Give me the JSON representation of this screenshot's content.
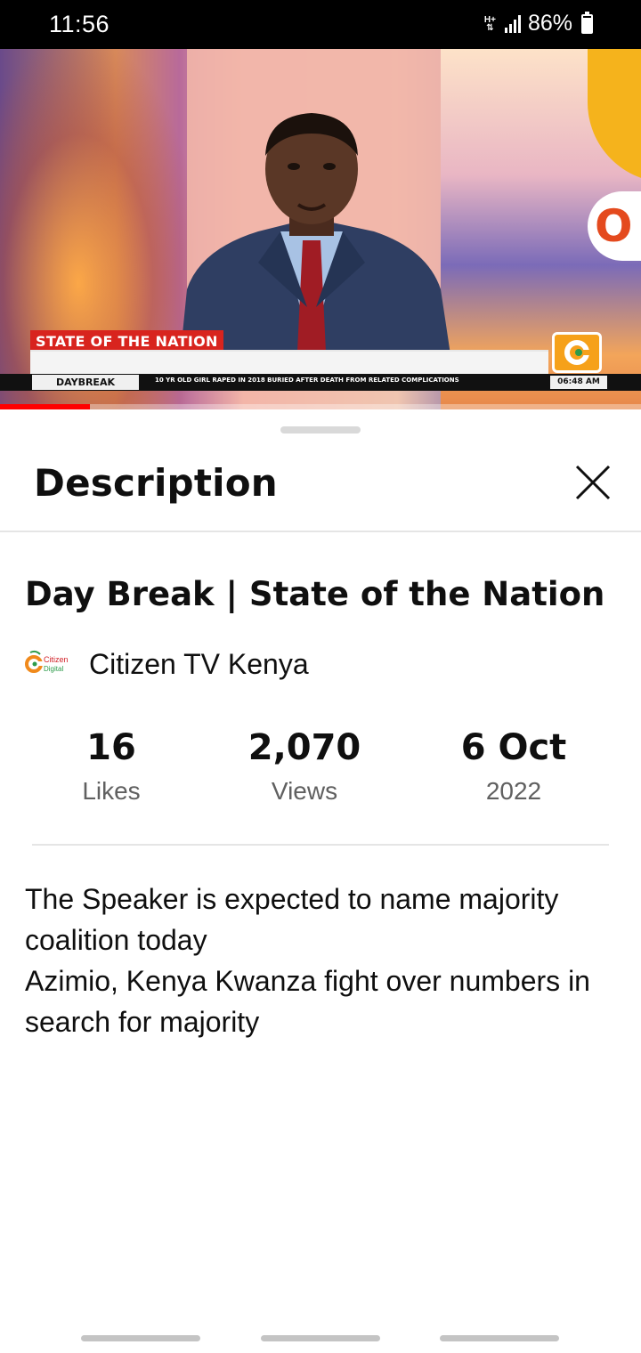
{
  "status_bar": {
    "time": "11:56",
    "network": "H+",
    "battery": "86%",
    "icons": [
      "network-type-icon",
      "signal-icon",
      "battery-icon"
    ]
  },
  "video": {
    "lower_third": "STATE OF THE NATION",
    "ticker_tag": "DAYBREAK",
    "ticker_text": "10 YR OLD GIRL RAPED IN 2018 BURIED AFTER DEATH FROM RELATED COMPLICATIONS",
    "ticker_time": "06:48 AM",
    "progress_fraction": 0.14,
    "accent_color": "#ff0000"
  },
  "sheet": {
    "title": "Description",
    "close_icon": "close-icon"
  },
  "details": {
    "title": "Day Break | State of the Nation",
    "channel": {
      "name": "Citizen TV Kenya",
      "logo_text_top": "Citizen",
      "logo_text_bottom": "Digital"
    },
    "stats": [
      {
        "value": "16",
        "label": "Likes"
      },
      {
        "value": "2,070",
        "label": "Views"
      },
      {
        "value": "6 Oct",
        "label": "2022"
      }
    ],
    "description_lines": [
      "The Speaker is expected to name majority coalition today",
      "Azimio, Kenya Kwanza fight over numbers in search for majority"
    ]
  }
}
